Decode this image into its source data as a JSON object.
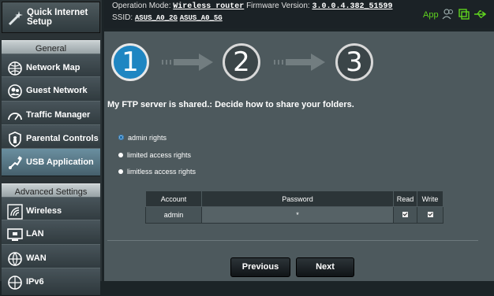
{
  "sidebar": {
    "quick_setup_label": "Quick Internet\nSetup",
    "general_header": "General",
    "advanced_header": "Advanced Settings",
    "general_items": [
      {
        "label": "Network Map",
        "icon": "network-map-icon"
      },
      {
        "label": "Guest Network",
        "icon": "guest-network-icon"
      },
      {
        "label": "Traffic Manager",
        "icon": "traffic-manager-icon"
      },
      {
        "label": "Parental Controls",
        "icon": "parental-controls-icon"
      },
      {
        "label": "USB Application",
        "icon": "usb-application-icon",
        "active": true
      }
    ],
    "advanced_items": [
      {
        "label": "Wireless",
        "icon": "wireless-icon"
      },
      {
        "label": "LAN",
        "icon": "lan-icon"
      },
      {
        "label": "WAN",
        "icon": "wan-icon"
      },
      {
        "label": "IPv6",
        "icon": "ipv6-icon"
      }
    ]
  },
  "topbar": {
    "operation_mode_label": "Operation Mode:",
    "operation_mode_value": "Wireless router",
    "firmware_label": "Firmware Version:",
    "firmware_value": "3.0.0.4.382_51599",
    "ssid_label": "SSID:",
    "ssid_1": "ASUS_A0_2G",
    "ssid_2": "ASUS_A0_5G",
    "app_label": "App"
  },
  "wizard": {
    "steps": [
      "1",
      "2",
      "3"
    ],
    "active_step": 1,
    "heading": "My FTP server is shared.: Decide how to share your folders.",
    "options": [
      {
        "label": "admin rights",
        "checked": true
      },
      {
        "label": "limited access rights",
        "checked": false
      },
      {
        "label": "limitless access rights",
        "checked": false
      }
    ],
    "table": {
      "headers": [
        "Account",
        "Password",
        "Read",
        "Write"
      ],
      "rows": [
        {
          "account": "admin",
          "password": "*",
          "read": true,
          "write": true
        }
      ]
    },
    "buttons": {
      "previous": "Previous",
      "next": "Next"
    }
  },
  "colors": {
    "accent_blue": "#1f86c2",
    "app_green": "#5fd31f",
    "background": "#4d595d"
  }
}
